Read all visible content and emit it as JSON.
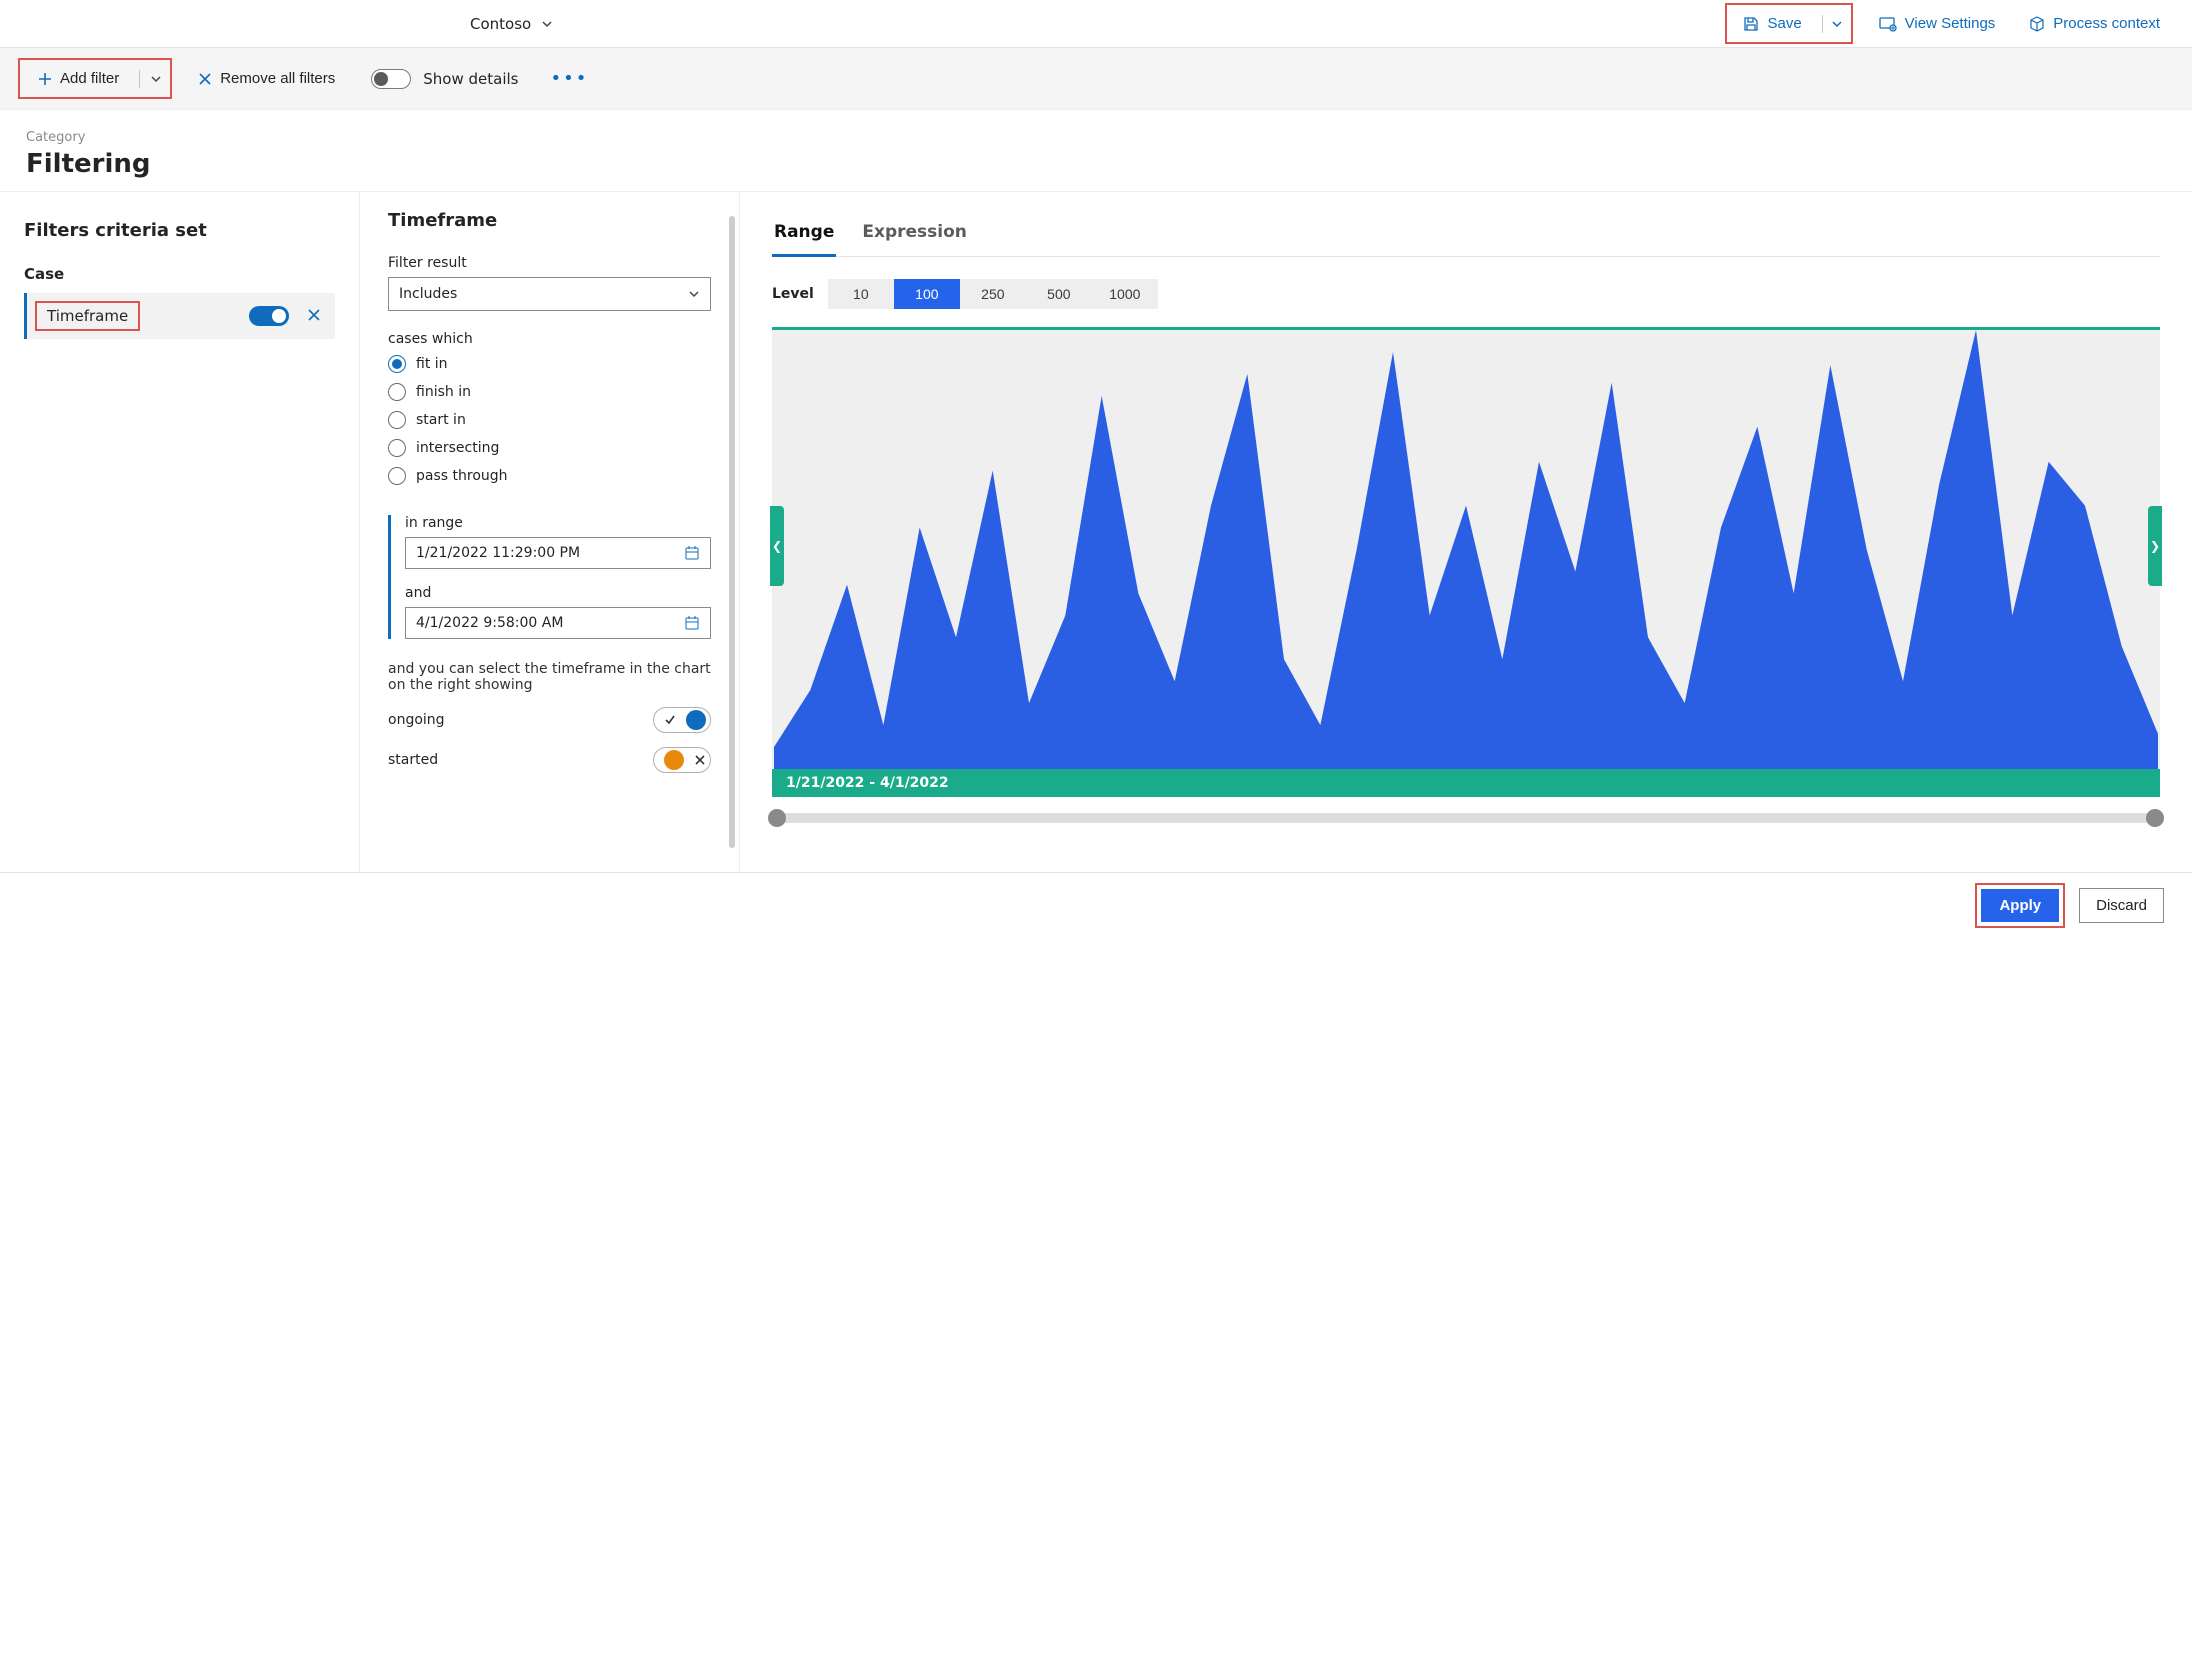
{
  "header": {
    "org": "Contoso",
    "save": "Save",
    "view_settings": "View Settings",
    "process_context": "Process context"
  },
  "commandBar": {
    "add_filter": "Add filter",
    "remove_all": "Remove all filters",
    "show_details": "Show details"
  },
  "page": {
    "category_label": "Category",
    "title": "Filtering"
  },
  "leftPanel": {
    "criteria_title": "Filters criteria set",
    "group_label": "Case",
    "filter_name": "Timeframe"
  },
  "midPanel": {
    "title": "Timeframe",
    "filter_result_label": "Filter result",
    "filter_result_value": "Includes",
    "cases_which_label": "cases which",
    "radios": {
      "fit_in": "fit in",
      "finish_in": "finish in",
      "start_in": "start in",
      "intersecting": "intersecting",
      "pass_through": "pass through"
    },
    "in_range_label": "in range",
    "date_from": "1/21/2022 11:29:00 PM",
    "and_label": "and",
    "date_to": "4/1/2022 9:58:00 AM",
    "chart_hint": "and you can select the timeframe in the chart on the right showing",
    "ongoing_label": "ongoing",
    "started_label": "started"
  },
  "rightPanel": {
    "tab_range": "Range",
    "tab_expression": "Expression",
    "level_label": "Level",
    "levels": [
      "10",
      "100",
      "250",
      "500",
      "1000"
    ],
    "selected_level": "100",
    "chart_caption": "1/21/2022 - 4/1/2022"
  },
  "footer": {
    "apply": "Apply",
    "discard": "Discard"
  },
  "chart_data": {
    "type": "area",
    "title": "",
    "x_range": [
      "1/21/2022",
      "4/1/2022"
    ],
    "ylim": [
      0,
      100
    ],
    "values": [
      5,
      18,
      42,
      10,
      55,
      30,
      68,
      15,
      35,
      85,
      40,
      20,
      60,
      90,
      25,
      10,
      50,
      95,
      35,
      60,
      25,
      70,
      45,
      88,
      30,
      15,
      55,
      78,
      40,
      92,
      50,
      20,
      65,
      100,
      35,
      70,
      60,
      28,
      8
    ]
  }
}
